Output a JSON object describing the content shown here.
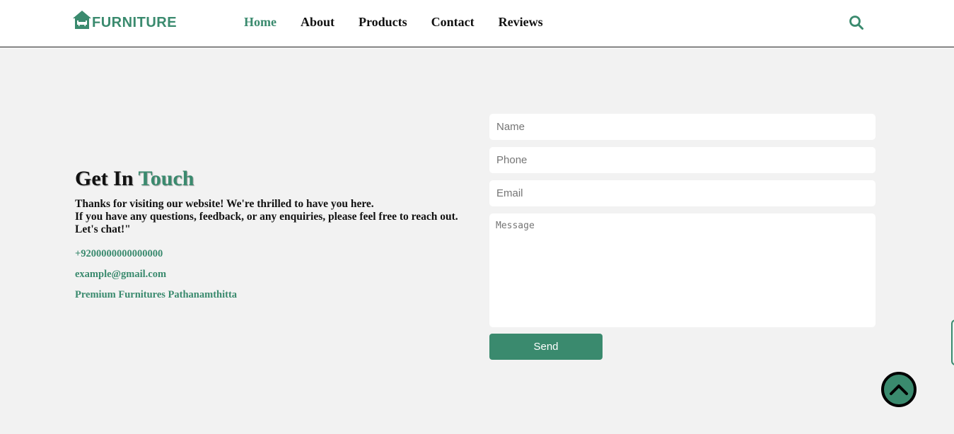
{
  "brand": {
    "name": "FURNITURE",
    "color": "#3a8a6e"
  },
  "nav": [
    {
      "label": "Home",
      "active": true
    },
    {
      "label": "About",
      "active": false
    },
    {
      "label": "Products",
      "active": false
    },
    {
      "label": "Contact",
      "active": false
    },
    {
      "label": "Reviews",
      "active": false
    }
  ],
  "header": {
    "search_icon": "search-icon"
  },
  "contact": {
    "title_main": "Get In ",
    "title_accent": "Touch",
    "desc_line1": "Thanks for visiting our website! We're thrilled to have you here.",
    "desc_line2": "If you have any questions, feedback, or any enquiries, please feel free to reach out. Let's chat!\"",
    "phone": "+9200000000000000",
    "email": "example@gmail.com",
    "address": "Premium Furnitures Pathanamthitta"
  },
  "form": {
    "name_placeholder": "Name",
    "phone_placeholder": "Phone",
    "email_placeholder": "Email",
    "message_placeholder": "Message",
    "send_label": "Send"
  },
  "scroll_top": {
    "icon": "chevron-up-icon"
  }
}
